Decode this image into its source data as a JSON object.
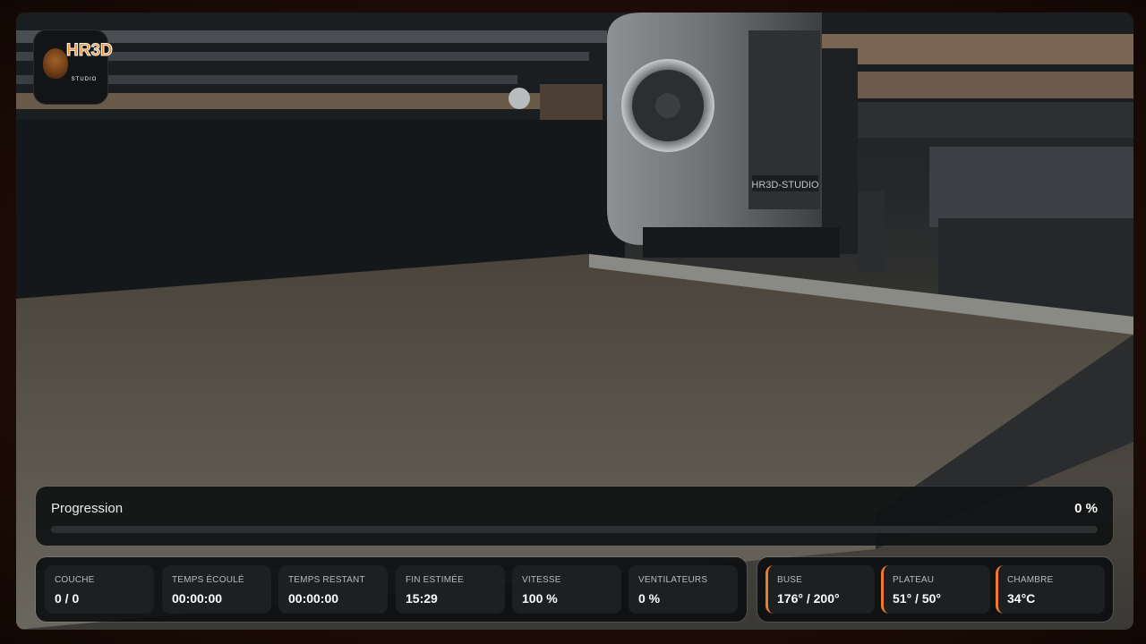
{
  "logo": {
    "text": "HR3D",
    "sub": "STUDIO"
  },
  "camera": {
    "printhead_label": "HR3D-STUDIO"
  },
  "progress": {
    "label": "Progression",
    "value_text": "0 %",
    "fraction": 0.0
  },
  "stats": [
    {
      "label": "COUCHE",
      "value": "0 / 0"
    },
    {
      "label": "TEMPS ÉCOULÉ",
      "value": "00:00:00"
    },
    {
      "label": "TEMPS RESTANT",
      "value": "00:00:00"
    },
    {
      "label": "FIN ESTIMÉE",
      "value": "15:29"
    },
    {
      "label": "VITESSE",
      "value": "100 %"
    },
    {
      "label": "VENTILATEURS",
      "value": "0 %"
    }
  ],
  "temperatures": [
    {
      "label": "BUSE",
      "value": "176° / 200°"
    },
    {
      "label": "PLATEAU",
      "value": "51° / 50°"
    },
    {
      "label": "CHAMBRE",
      "value": "34°C"
    }
  ],
  "colors": {
    "accent": "#f07a2a",
    "panel": "#101214",
    "card": "#1d2023",
    "frame": "#1c0c05"
  },
  "icons": {
    "logo": "hr3d-studio-logo"
  }
}
